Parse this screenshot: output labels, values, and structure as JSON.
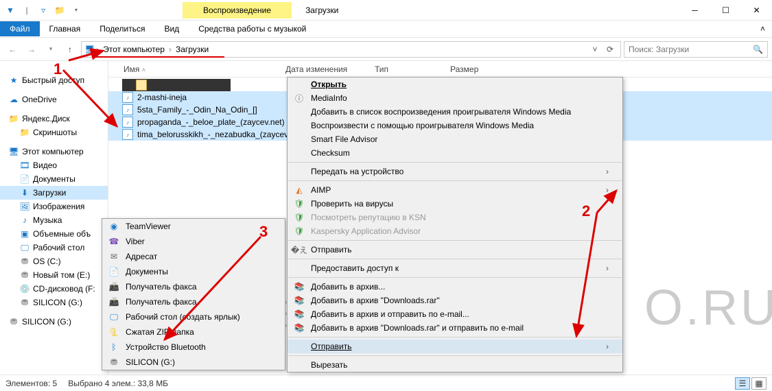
{
  "title": "Загрузки",
  "ribbon_context": "Воспроизведение",
  "ribbon_context_sub": "Средства работы с музыкой",
  "tabs": {
    "file": "Файл",
    "home": "Главная",
    "share": "Поделиться",
    "view": "Вид"
  },
  "breadcrumb": {
    "root": "Этот компьютер",
    "current": "Загрузки"
  },
  "search_placeholder": "Поиск: Загрузки",
  "columns": {
    "name": "Имя",
    "date": "Дата изменения",
    "type": "Тип",
    "size": "Размер"
  },
  "nav": {
    "quick": "Быстрый доступ",
    "onedrive": "OneDrive",
    "yadisk": "Яндекс.Диск",
    "screenshots": "Скриншоты",
    "thispc": "Этот компьютер",
    "video": "Видео",
    "documents": "Документы",
    "downloads": "Загрузки",
    "pictures": "Изображения",
    "music": "Музыка",
    "volumes": "Объемные объ",
    "desktop": "Рабочий стол",
    "osc": "OS (C:)",
    "newvol": "Новый том (E:)",
    "cd": "CD-дисковод (F:",
    "silicon": "SILICON (G:)",
    "silicon2": "SILICON (G:)"
  },
  "files": [
    {
      "name": "",
      "folder": true,
      "sel": false
    },
    {
      "name": "2-mashi-ineja",
      "folder": false,
      "sel": true
    },
    {
      "name": "5sta_Family_-_Odin_Na_Odin_[]",
      "folder": false,
      "sel": true
    },
    {
      "name": "propaganda_-_beloe_plate_(zaycev.net)",
      "folder": false,
      "sel": true
    },
    {
      "name": "tima_belorusskikh_-_nezabudka_(zaycev...",
      "folder": false,
      "sel": true
    }
  ],
  "sendto": {
    "teamviewer": "TeamViewer",
    "viber": "Viber",
    "recipient": "Адресат",
    "documents": "Документы",
    "fax1": "Получатель факса",
    "fax2": "Получатель факса",
    "desktop": "Рабочий стол (создать ярлык)",
    "zip": "Сжатая ZIP-папка",
    "bluetooth": "Устройство Bluetooth",
    "silicon": "SILICON (G:)"
  },
  "ctx": {
    "open": "Открыть",
    "mediainfo": "MediaInfo",
    "wmp_add": "Добавить в список воспроизведения проигрывателя Windows Media",
    "wmp_play": "Воспроизвести с помощью проигрывателя Windows Media",
    "sfa": "Smart File Advisor",
    "checksum": "Checksum",
    "cast": "Передать на устройство",
    "aimp": "AIMP",
    "scan": "Проверить на вирусы",
    "ksn": "Посмотреть репутацию в KSN",
    "kaa": "Kaspersky Application Advisor",
    "send": "Отправить",
    "share": "Предоставить доступ к",
    "rar_add": "Добавить в архив...",
    "rar_dl": "Добавить в архив \"Downloads.rar\"",
    "rar_mail": "Добавить в архив и отправить по e-mail...",
    "rar_dl_mail": "Добавить в архив \"Downloads.rar\" и отправить по e-mail",
    "send2": "Отправить",
    "cut": "Вырезать"
  },
  "annotations": {
    "n1": "1",
    "n2": "2",
    "n3": "3"
  },
  "status": {
    "count": "Элементов: 5",
    "selection": "Выбрано 4 элем.: 33,8 МБ"
  },
  "watermark_left": "ONEK",
  "watermark_right": "O.RU"
}
